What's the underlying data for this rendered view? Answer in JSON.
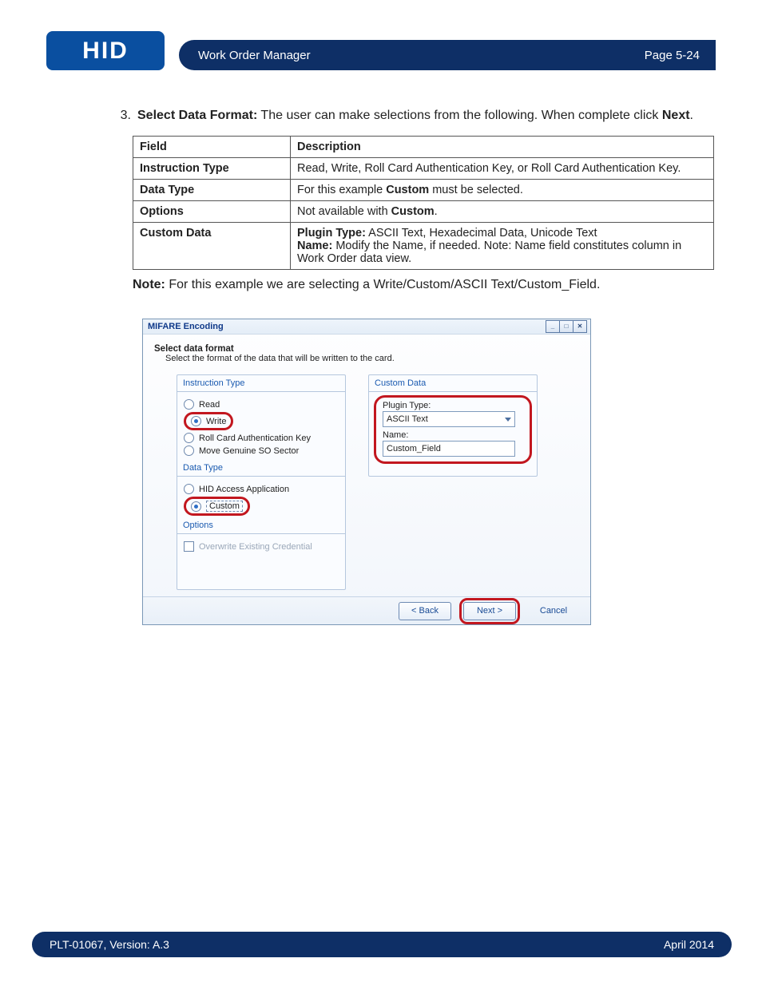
{
  "logo_text": "HID",
  "header": {
    "title": "Work Order Manager",
    "page": "Page 5-24"
  },
  "step": {
    "number": "3.",
    "label": "Select Data Format:",
    "text": " The user can make selections from the following. When complete click ",
    "next_word": "Next",
    "period": "."
  },
  "table": {
    "head": {
      "field": "Field",
      "desc": "Description"
    },
    "rows": [
      {
        "field": "Instruction Type",
        "desc": "Read, Write, Roll Card Authentication Key, or Roll Card Authentication Key."
      },
      {
        "field": "Data Type",
        "desc_pre": "For this example ",
        "desc_bold": "Custom",
        "desc_post": " must be selected."
      },
      {
        "field": "Options",
        "desc_pre": "Not available with ",
        "desc_bold": "Custom",
        "desc_post": "."
      },
      {
        "field": "Custom Data",
        "line1_bold": "Plugin Type:",
        "line1_rest": " ASCII Text, Hexadecimal Data, Unicode Text",
        "line2_bold": "Name:",
        "line2_rest": " Modify the Name, if needed. Note: Name field constitutes column in Work Order data view."
      }
    ]
  },
  "note": {
    "label": "Note:",
    "text": " For this example we are selecting a Write/Custom/ASCII Text/Custom_Field."
  },
  "dialog": {
    "title": "MIFARE Encoding",
    "win_min": "_",
    "win_max": "□",
    "win_close": "✕",
    "head1": "Select data format",
    "head2": "Select the format of the data that will be written to the card.",
    "left": {
      "sec_instruction": "Instruction Type",
      "read": "Read",
      "write": "Write",
      "rollkey": "Roll Card Authentication Key",
      "move": "Move Genuine SO Sector",
      "sec_datatype": "Data Type",
      "hidapp": "HID Access Application",
      "custom": "Custom",
      "sec_options": "Options",
      "overwrite": "Overwrite Existing Credential"
    },
    "right": {
      "sec": "Custom Data",
      "plugin_label": "Plugin Type:",
      "plugin_value": "ASCII Text",
      "name_label": "Name:",
      "name_value": "Custom_Field"
    },
    "buttons": {
      "back": "< Back",
      "next": "Next >",
      "cancel": "Cancel"
    }
  },
  "footer": {
    "left": "PLT-01067, Version: A.3",
    "right": "April 2014"
  }
}
